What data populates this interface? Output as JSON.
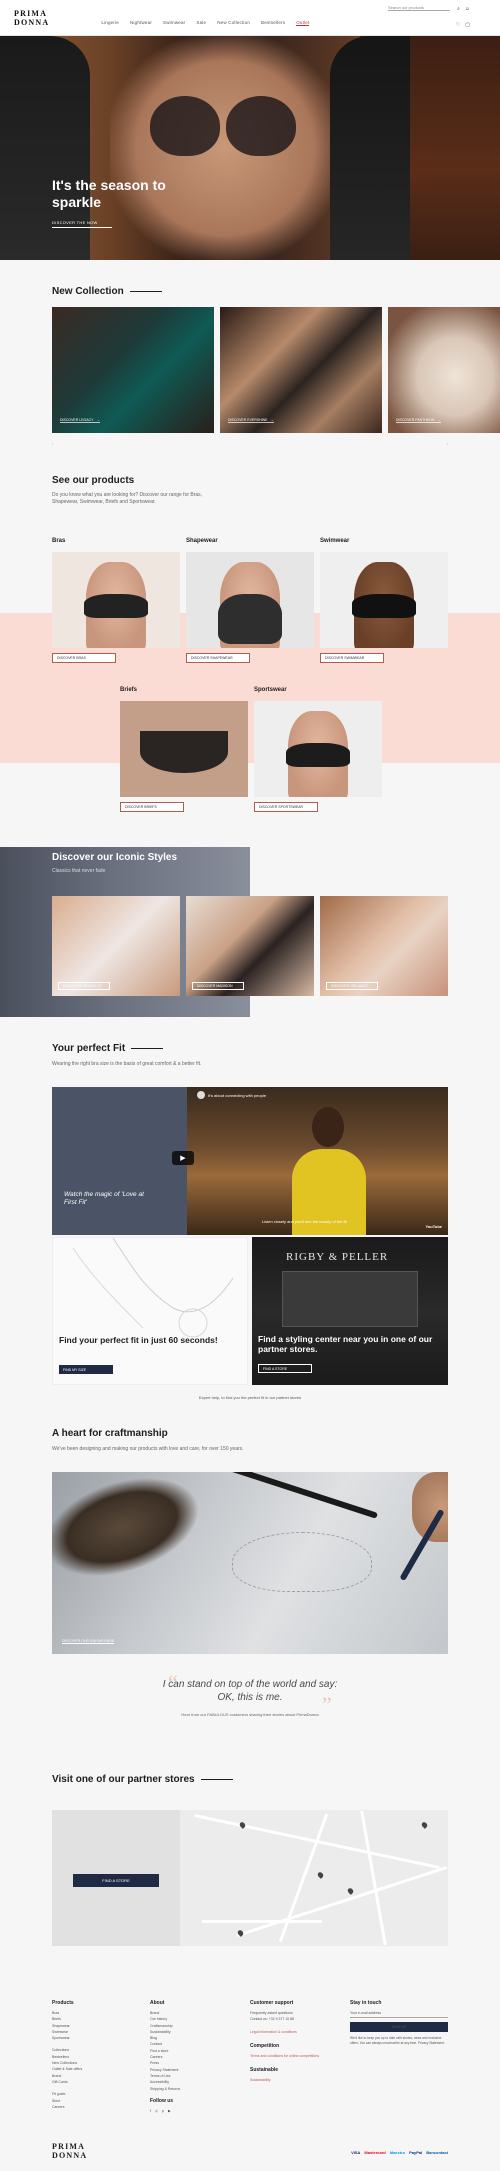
{
  "header": {
    "logo_line1": "PRIMA",
    "logo_line2": "DONNA",
    "nav": [
      "Lingerie",
      "Nightwear",
      "Swimwear",
      "Sale",
      "New Collection",
      "Bestsellers",
      "Outlet"
    ],
    "search_placeholder": "Search our products",
    "icons": [
      "search-icon",
      "user-icon",
      "heart-icon",
      "bag-icon"
    ]
  },
  "hero": {
    "title": "It's the season to sparkle",
    "cta": "DISCOVER THE NOW"
  },
  "new_collection": {
    "title": "New Collection",
    "cards": [
      {
        "label": "DISCOVER LEGACY"
      },
      {
        "label": "DISCOVER EVERSHINE"
      },
      {
        "label": "DISCOVER PANTHEON"
      }
    ],
    "prev": "‹",
    "next": "›"
  },
  "products": {
    "title": "See our products",
    "subtitle": "Do you know what you are looking for? Discover our range for Bras, Shapewear, Swimwear, Briefs and Sportswear.",
    "items": [
      {
        "name": "Bras",
        "button": "DISCOVER BRAS"
      },
      {
        "name": "Shapewear",
        "button": "DISCOVER SHAPEWEAR"
      },
      {
        "name": "Swimwear",
        "button": "DISCOVER SWIMWEAR"
      },
      {
        "name": "Briefs",
        "button": "DISCOVER BRIEFS"
      },
      {
        "name": "Sportswear",
        "button": "DISCOVER SPORTSWEAR"
      }
    ]
  },
  "iconic": {
    "title": "Discover our Iconic Styles",
    "subtitle": "Classics that never fade",
    "cards": [
      {
        "label": "DISCOVER DEAUVILLE"
      },
      {
        "label": "DISCOVER MADISON"
      },
      {
        "label": "DISCOVER ORLANDO"
      }
    ]
  },
  "fit": {
    "title": "Your perfect Fit",
    "subtitle": "Wearing the right bra size is the basis of great comfort & a better fit.",
    "video_title": "It's about connecting with people",
    "video_caption": "Watch the magic of 'Love at First Fit'",
    "video_subtitle": "Listen closely and you'll see the beauty of the fit",
    "video_brand": "YouTube",
    "card1_title": "Find your perfect fit in just 60 seconds!",
    "card1_button": "FIND MY SIZE",
    "card2_title": "Find a styling center near you in one of our partner stores.",
    "card2_button": "FIND A STORE",
    "card2_store": "RIGBY & PELLER",
    "caption": "Expert help, to find you the perfect fit in our partner stores"
  },
  "craft": {
    "title": "A heart for craftmanship",
    "subtitle": "We've been designing and making our products with love and care, for over 150 years.",
    "image_label": "DISCOVER OUR SAVOIR-FAIRE",
    "quote": "I can stand on top of the world and say: OK, this is me.",
    "quote_by": "Hear from our FABULOUS customers sharing their stories about PrimaDonna"
  },
  "stores": {
    "title": "Visit one of our partner stores",
    "button": "FIND A STORE"
  },
  "footer": {
    "col1_title": "Products",
    "col1_items": [
      "Bras",
      "Briefs",
      "Shapewear",
      "Swimwear",
      "Sportswear",
      "",
      "Collections",
      "Bestsellers",
      "New Collections",
      "Outlet & Sale offers",
      "Brand",
      "Gift Cards",
      "",
      "Fit guide",
      "Store",
      "Careers"
    ],
    "col2_title": "About",
    "col2_items": [
      "Brand",
      "Our history",
      "Craftsmanship",
      "Sustainability",
      "Blog",
      "Contact",
      "Find a store",
      "Careers",
      "Press",
      "Privacy Statement",
      "Terms of Use",
      "Accessibility",
      "Shipping & Returns"
    ],
    "col2_follow": "Follow us",
    "col3_title": "Customer support",
    "col3_lines": [
      "Frequently asked questions",
      "Contact us: +32 9 377 10 88",
      "",
      "Legal information & conditions"
    ],
    "col3_comp_title": "Competition",
    "col3_comp_lines": [
      "Terms and conditions for online competitions"
    ],
    "col3_sup_title": "Sustainable",
    "col3_sup_lines": [
      "Sustainability"
    ],
    "col4_title": "Stay in touch",
    "col4_input": "Your e-mail address",
    "col4_button": "SIGN UP",
    "col4_note": "We'd like to keep you up to date with stories, news and exclusive offers. You can always unsubscribe at any time. Privacy Statement.",
    "logo_line1": "PRIMA",
    "logo_line2": "DONNA",
    "payments": [
      "VISA",
      "Mastercard",
      "Maestro",
      "PayPal",
      "Bancontact"
    ]
  },
  "colors": {
    "accent": "#b45b4f",
    "navy": "#1f2a44",
    "pink_band": "#fadcd4",
    "sale": "#b2383b"
  }
}
